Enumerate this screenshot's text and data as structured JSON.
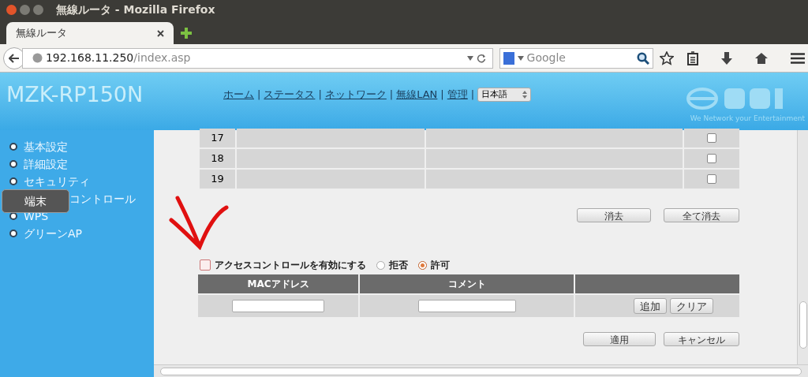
{
  "window": {
    "title": "無線ルータ - Mozilla Firefox"
  },
  "tabs": [
    {
      "label": "無線ルータ",
      "selected": true
    }
  ],
  "address": {
    "host": "192.168.11.250",
    "path": "/index.asp"
  },
  "search": {
    "placeholder": "Google"
  },
  "header": {
    "model": "MZK-RP150N",
    "nav": [
      "ホーム",
      "ステータス",
      "ネットワーク",
      "無線LAN",
      "管理"
    ],
    "nav_separator": "|",
    "language": "日本語",
    "tagline": "We Network your Entertainment"
  },
  "sidebar": {
    "items": [
      {
        "label": "基本設定"
      },
      {
        "label": "詳細設定"
      },
      {
        "label": "セキュリティ"
      },
      {
        "label": "コントロール",
        "kind": "covered"
      },
      {
        "label": "WPS"
      },
      {
        "label": "グリーンAP"
      }
    ],
    "tooltip": "端末"
  },
  "rows": [
    {
      "number": "17",
      "checked": false
    },
    {
      "number": "18",
      "checked": false
    },
    {
      "number": "19",
      "checked": false
    }
  ],
  "delete_buttons": [
    "消去",
    "全て消去"
  ],
  "access_control": {
    "label": "アクセスコントロールを有効にする",
    "enabled": false,
    "options": [
      {
        "label": "拒否",
        "selected": false
      },
      {
        "label": "許可",
        "selected": true
      }
    ]
  },
  "mac_table": {
    "columns": [
      "MACアドレス",
      "コメント"
    ],
    "buttons": [
      "追加",
      "クリア"
    ]
  },
  "footer_buttons": [
    "適用",
    "キャンセル"
  ]
}
